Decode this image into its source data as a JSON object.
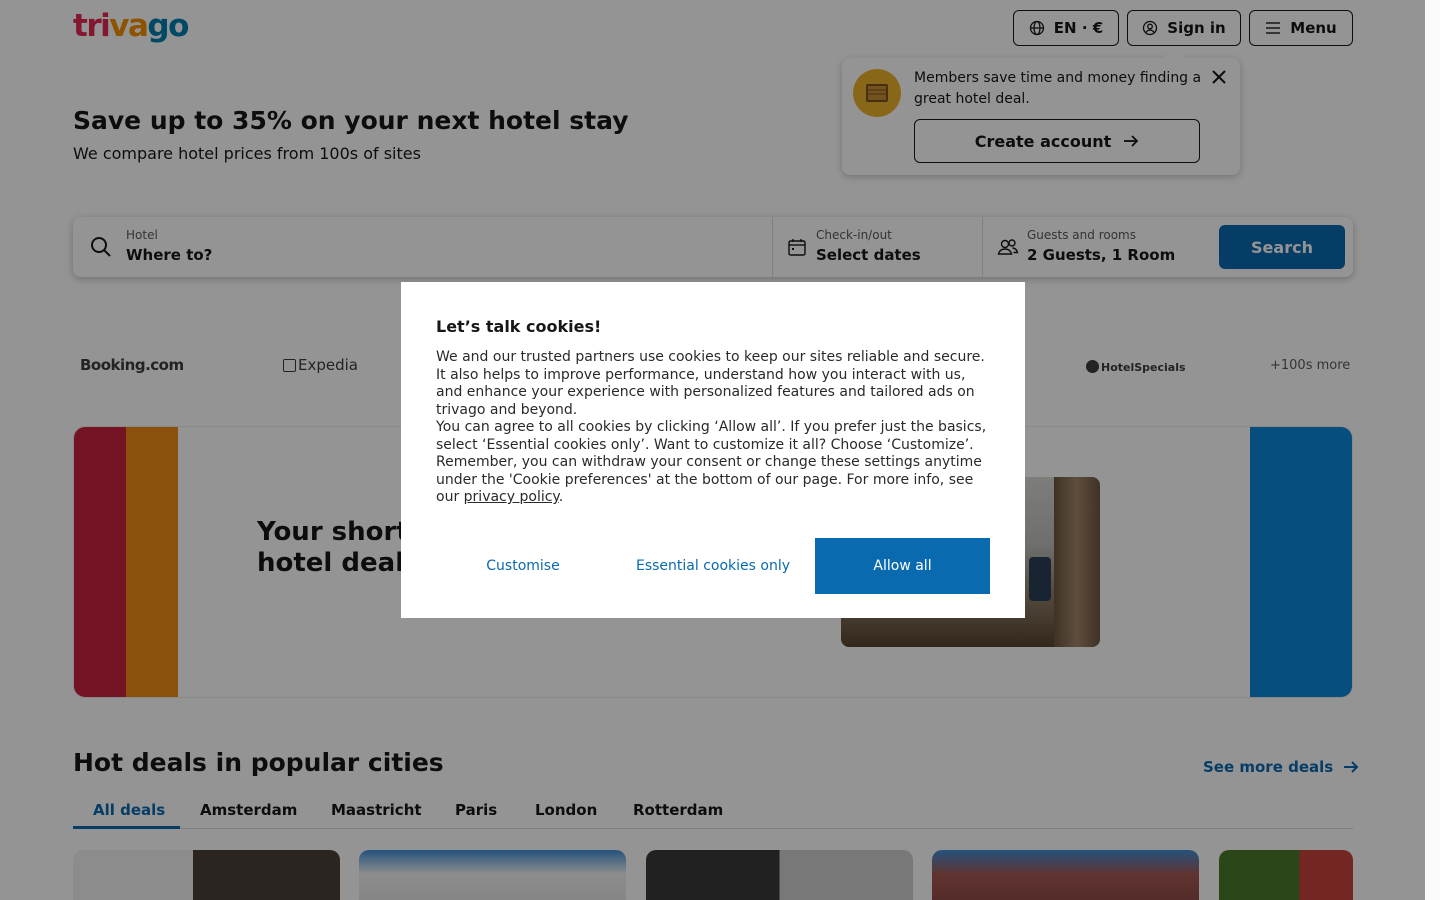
{
  "header": {
    "logo": {
      "part1": "tri",
      "part2": "va",
      "part3": "go"
    },
    "language": "EN · €",
    "sign_in": "Sign in",
    "menu": "Menu"
  },
  "member_popover": {
    "message": "Members save time and money finding a great hotel deal.",
    "create_account": "Create account"
  },
  "hero": {
    "title": "Save up to 35% on your next hotel stay",
    "subtitle": "We compare hotel prices from 100s of sites"
  },
  "search": {
    "destination": {
      "label": "Hotel",
      "value": "Where to?"
    },
    "dates": {
      "label": "Check-in/out",
      "value": "Select dates"
    },
    "guests": {
      "label": "Guests and rooms",
      "value": "2 Guests, 1 Room"
    },
    "button": "Search"
  },
  "partners": [
    "Booking.com",
    "Expedia",
    "HotelSpecials",
    "+100s more"
  ],
  "banner": {
    "title": "Your shortcut to finding a great hotel deal"
  },
  "hot_deals": {
    "title": "Hot deals in popular cities",
    "see_more": "See more deals",
    "tabs": [
      "All deals",
      "Amsterdam",
      "Maastricht",
      "Paris",
      "London",
      "Rotterdam"
    ],
    "active_tab": "All deals"
  },
  "cookie_modal": {
    "title": "Let’s talk cookies!",
    "paragraph1": "We and our trusted partners use cookies to keep our sites reliable and secure. It also helps to improve performance, understand how you interact with us, and enhance your experience with personalized features and tailored ads on trivago and beyond.",
    "paragraph2_prefix": "You can agree to all cookies by clicking ‘Allow all’. If you prefer just the basics, select ‘Essential cookies only’. Want to customize it all? Choose ‘Customize’. Remember, you can withdraw your consent or change these settings anytime under the 'Cookie preferences' at the bottom of our page. For more info, see our ",
    "privacy_link": "privacy policy",
    "paragraph2_suffix": ".",
    "customise": "Customise",
    "essential": "Essential cookies only",
    "allow_all": "Allow all"
  },
  "colors": {
    "brand_blue": "#0a6ab0",
    "brand_red": "#e32851",
    "brand_orange": "#f48f00",
    "brand_teal": "#007fad",
    "banner_red": "#c8213f",
    "banner_orange": "#ef8a14",
    "banner_blue": "#0a87d8"
  }
}
